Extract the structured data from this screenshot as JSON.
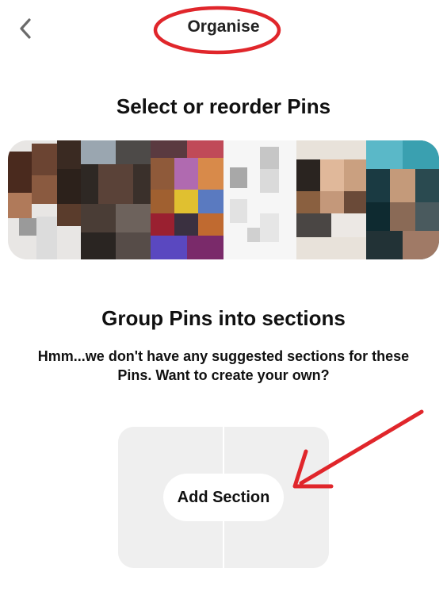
{
  "header": {
    "back_icon": "chevron-left-icon",
    "title": "Organise"
  },
  "pins_section": {
    "heading": "Select or reorder Pins",
    "thumbnail_count": 6
  },
  "sections_section": {
    "heading": "Group Pins into sections",
    "message": "Hmm...we don't have any suggested sections for these Pins. Want to create your own?",
    "add_button_label": "Add Section"
  },
  "annotations": {
    "title_highlight_color": "#e0262b",
    "arrow_color": "#e0262b"
  }
}
